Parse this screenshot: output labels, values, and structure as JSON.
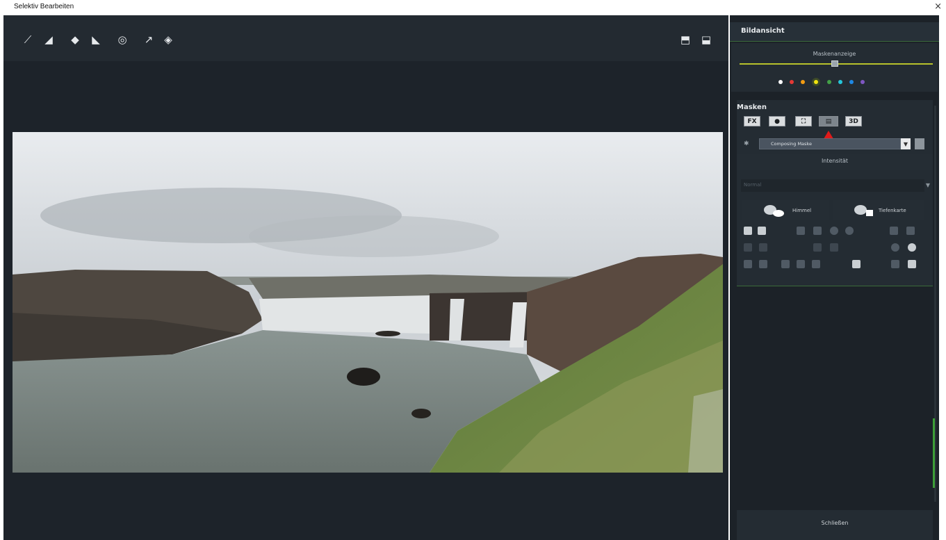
{
  "window": {
    "title": "Selektiv Bearbeiten",
    "close_glyph": "×"
  },
  "toolbar": {
    "icons": [
      "brush-icon",
      "brush-erase-icon",
      "eraser-icon",
      "eraser-soft-icon",
      "target-icon",
      "wand-icon",
      "fill-icon"
    ],
    "right_icons": [
      "load-mask-icon",
      "save-mask-icon"
    ]
  },
  "panel": {
    "bildansicht": "Bildansicht",
    "maskenanzeige": "Maskenanzeige",
    "colors": [
      "#ffffff",
      "#e53935",
      "#f39c12",
      "#f1e40f",
      "#43a047",
      "#26c6da",
      "#1e88e5",
      "#7e57c2"
    ],
    "selected_color": 3,
    "masken": {
      "heading": "Masken",
      "types": [
        "FX",
        "●",
        "⛶",
        "▤",
        "3D"
      ],
      "combo_value": "Composing Maske",
      "intensity_label": "Intensität",
      "select_placeholder": "Normal",
      "ai_himmel": "Himmel",
      "ai_tiefenkarte": "Tiefenkarte"
    },
    "close_button": "Schließen",
    "accent": "#b8c22c",
    "pointer_color": "#e01a1a"
  }
}
